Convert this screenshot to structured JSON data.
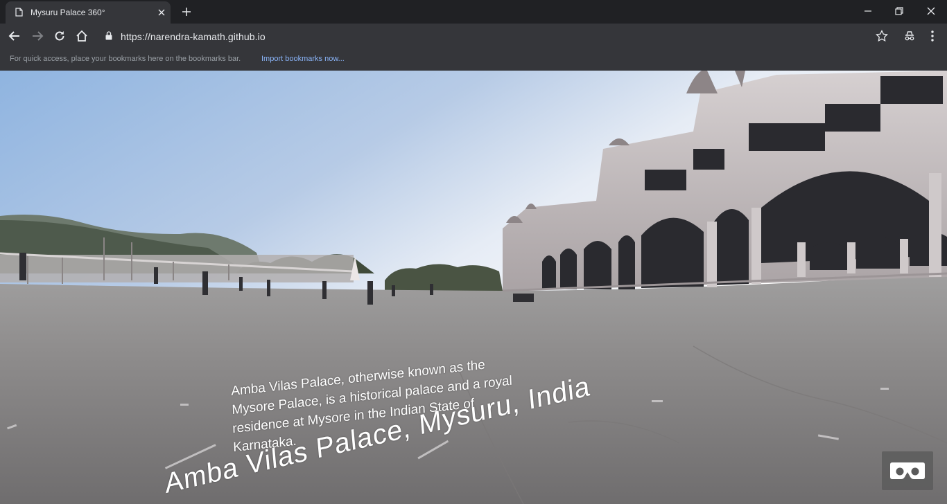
{
  "browser": {
    "tab_title": "Mysuru Palace 360°",
    "url": "https://narendra-kamath.github.io",
    "bookmarks_hint": "For quick access, place your bookmarks here on the bookmarks bar.",
    "import_bookmarks": "Import bookmarks now..."
  },
  "scene": {
    "info_text": "Amba Vilas Palace, otherwise known as the Mysore Palace, is a historical palace and a royal residence at Mysore in the Indian State of Karnataka.",
    "place_title": "Amba Vilas Palace, Mysuru, India"
  },
  "icons": {
    "tab": "document-icon",
    "close": "close-icon",
    "new_tab": "plus-icon",
    "back": "back-arrow-icon",
    "forward": "forward-arrow-icon",
    "reload": "reload-icon",
    "home": "home-icon",
    "lock": "lock-icon",
    "star": "star-icon",
    "extension": "incognito-extension-icon",
    "menu": "kebab-menu-icon",
    "vr": "vr-headset-icon"
  },
  "colors": {
    "chrome_dark": "#202124",
    "toolbar": "#35363a",
    "link": "#8ab4f8"
  }
}
